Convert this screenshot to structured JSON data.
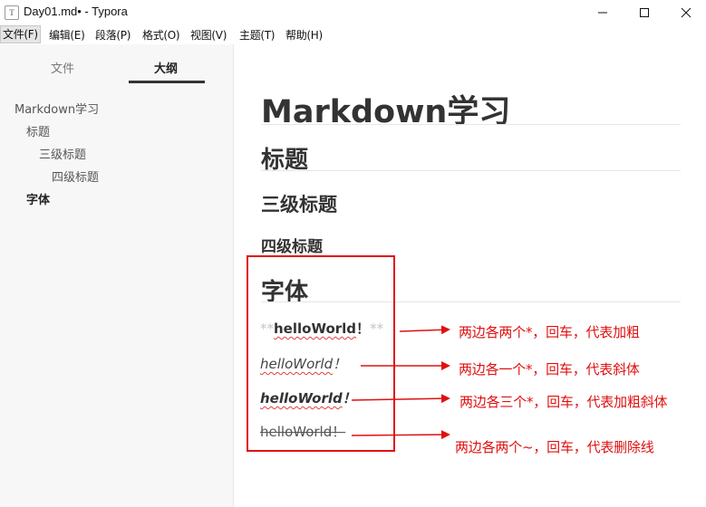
{
  "window": {
    "app_icon": "T",
    "title": "Day01.md• - Typora",
    "controls": [
      "minimize-icon",
      "maximize-icon",
      "close-icon"
    ]
  },
  "menu": {
    "items": [
      {
        "label": "文件(F)",
        "active": true
      },
      {
        "label": "编辑(E)"
      },
      {
        "label": "段落(P)"
      },
      {
        "label": "格式(O)"
      },
      {
        "label": "视图(V)"
      },
      {
        "label": "主题(T)"
      },
      {
        "label": "帮助(H)"
      }
    ]
  },
  "sidebar": {
    "tabs": {
      "files": "文件",
      "outline": "大纲"
    },
    "active_tab": "outline",
    "outline": [
      {
        "label": "Markdown学习",
        "level": 1
      },
      {
        "label": "标题",
        "level": 2
      },
      {
        "label": "三级标题",
        "level": 3
      },
      {
        "label": "四级标题",
        "level": 4
      },
      {
        "label": "字体",
        "level": 2
      }
    ]
  },
  "editor": {
    "h1": "Markdown学习",
    "h2_title": "标题",
    "h3": "三级标题",
    "h4": "四级标题",
    "h2_font": "字体",
    "bold_line": {
      "marker_left": "**",
      "text": "helloWorld",
      "punct": "！",
      "marker_right": "**"
    },
    "italic_line": {
      "text": "helloWorld",
      "punct": "！"
    },
    "bold_italic_line": {
      "text": "helloWorld",
      "punct": "！"
    },
    "strike_line": {
      "text": "helloWorld",
      "punct": "！"
    }
  },
  "annotations": {
    "color": "#e01010",
    "bold_note": "两边各两个*，回车，代表加粗",
    "italic_note": "两边各一个*，回车，代表斜体",
    "bold_italic_note": "两边各三个*，回车，代表加粗斜体",
    "strike_note": "两边各两个~，回车，代表删除线"
  }
}
